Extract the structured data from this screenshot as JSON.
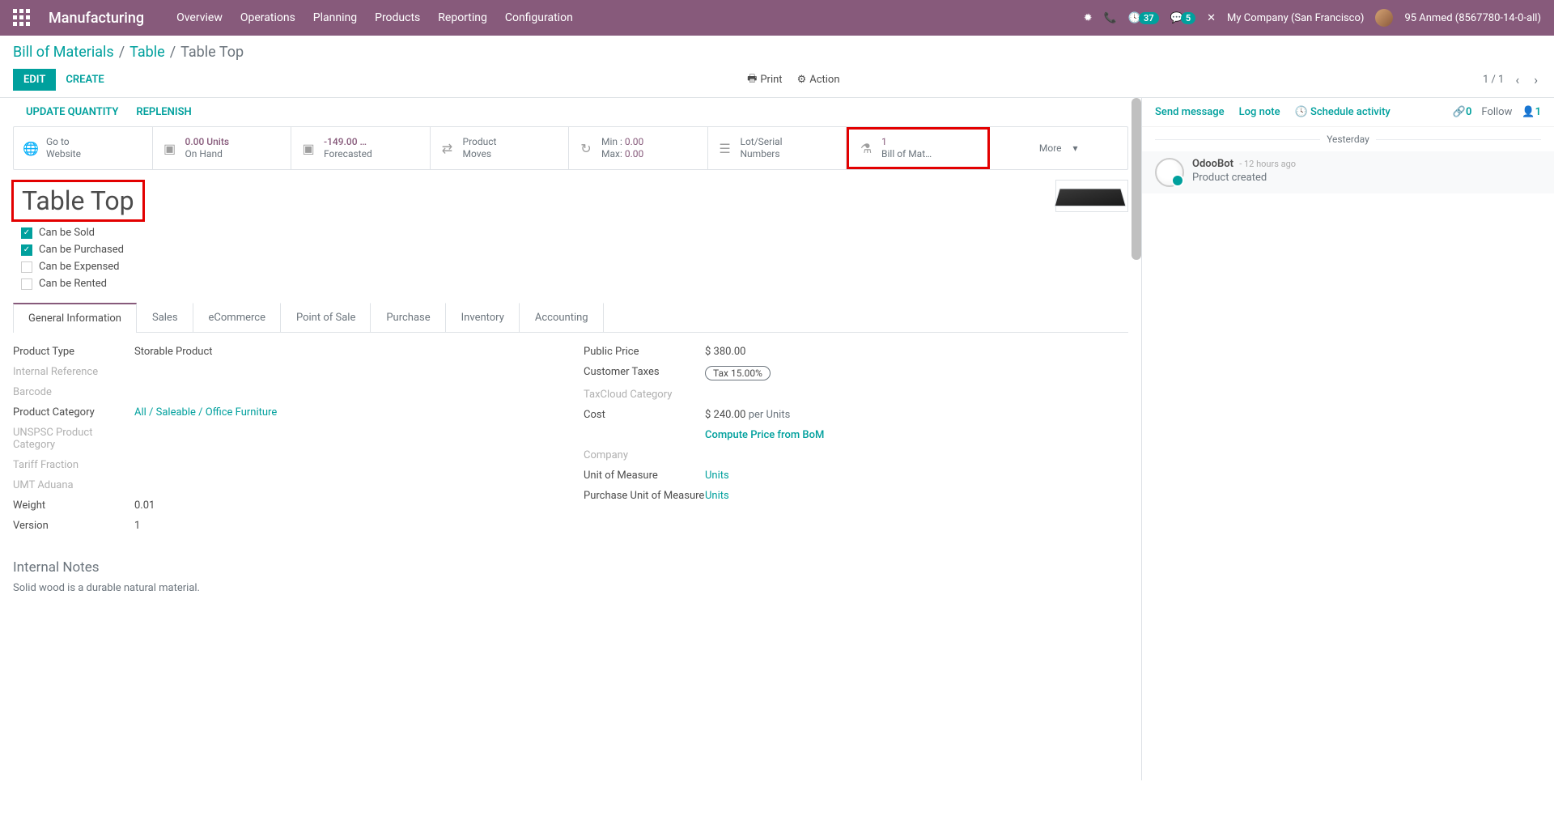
{
  "navbar": {
    "brand": "Manufacturing",
    "menu": [
      "Overview",
      "Operations",
      "Planning",
      "Products",
      "Reporting",
      "Configuration"
    ],
    "activity_count": "37",
    "msg_count": "5",
    "company": "My Company (San Francisco)",
    "user": "95 Anmed (8567780-14-0-all)"
  },
  "breadcrumb": {
    "a": "Bill of Materials",
    "b": "Table",
    "c": "Table Top"
  },
  "buttons": {
    "edit": "EDIT",
    "create": "CREATE",
    "print": "Print",
    "action": "Action"
  },
  "pager": "1 / 1",
  "sub_actions": {
    "update_qty": "UPDATE QUANTITY",
    "replenish": "REPLENISH"
  },
  "stats": {
    "website": "Go to\nWebsite",
    "onhand_val": "0.00 Units",
    "onhand_lbl": "On Hand",
    "forecast_val": "-149.00 …",
    "forecast_lbl": "Forecasted",
    "moves": "Product\nMoves",
    "min_lbl": "Min :",
    "min_val": "0.00",
    "max_lbl": "Max:",
    "max_val": "0.00",
    "lot": "Lot/Serial\nNumbers",
    "bom_val": "1",
    "bom_lbl": "Bill of Mat…",
    "more": "More"
  },
  "title": "Table Top",
  "checks": {
    "sold": "Can be Sold",
    "purchased": "Can be Purchased",
    "expensed": "Can be Expensed",
    "rented": "Can be Rented"
  },
  "tabs": [
    "General Information",
    "Sales",
    "eCommerce",
    "Point of Sale",
    "Purchase",
    "Inventory",
    "Accounting"
  ],
  "fields_left": {
    "product_type": {
      "lbl": "Product Type",
      "val": "Storable Product"
    },
    "internal_ref": {
      "lbl": "Internal Reference",
      "val": ""
    },
    "barcode": {
      "lbl": "Barcode",
      "val": ""
    },
    "category": {
      "lbl": "Product Category",
      "val": "All / Saleable / Office Furniture"
    },
    "unspsc": {
      "lbl": "UNSPSC Product Category",
      "val": ""
    },
    "tariff": {
      "lbl": "Tariff Fraction",
      "val": ""
    },
    "umt": {
      "lbl": "UMT Aduana",
      "val": ""
    },
    "weight": {
      "lbl": "Weight",
      "val": "0.01"
    },
    "version": {
      "lbl": "Version",
      "val": "1"
    }
  },
  "fields_right": {
    "public_price": {
      "lbl": "Public Price",
      "val": "$ 380.00"
    },
    "cust_tax": {
      "lbl": "Customer Taxes",
      "val": "Tax 15.00%"
    },
    "taxcloud": {
      "lbl": "TaxCloud Category",
      "val": ""
    },
    "cost": {
      "lbl": "Cost",
      "val": "$ 240.00",
      "unit": "per Units"
    },
    "compute": "Compute Price from BoM",
    "company": {
      "lbl": "Company",
      "val": ""
    },
    "uom": {
      "lbl": "Unit of Measure",
      "val": "Units"
    },
    "puom": {
      "lbl": "Purchase Unit of Measure",
      "val": "Units"
    }
  },
  "notes": {
    "title": "Internal Notes",
    "text": "Solid wood is a durable natural material."
  },
  "chatter": {
    "send": "Send message",
    "log": "Log note",
    "schedule": "Schedule activity",
    "attach_count": "0",
    "follow": "Follow",
    "follower_count": "1",
    "date_sep": "Yesterday",
    "msg_author": "OdooBot",
    "msg_time": "- 12 hours ago",
    "msg_text": "Product created"
  }
}
